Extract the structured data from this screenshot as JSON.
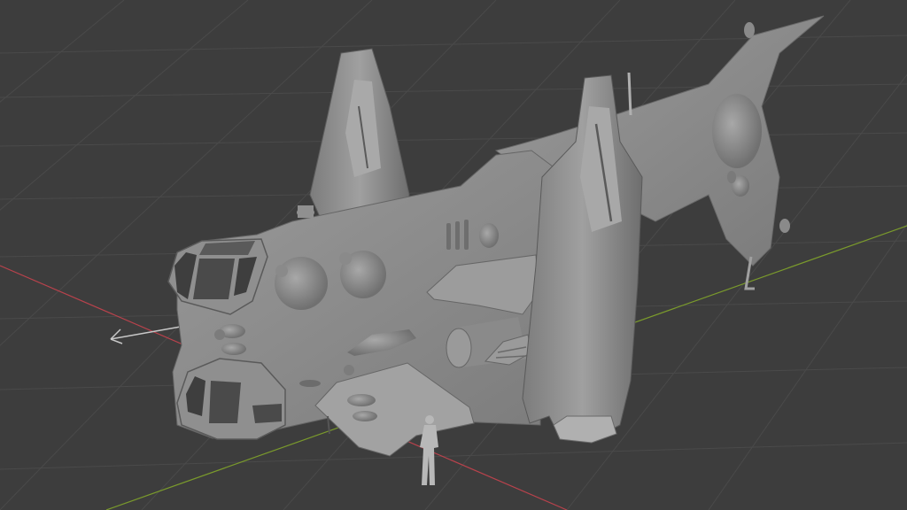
{
  "viewport": {
    "background": "#3d3d3d",
    "grid_color": "#4a4a4a",
    "x_axis_color": "#b8424c",
    "y_axis_color": "#7a9a2c",
    "grid": true
  },
  "scene": {
    "model": "tiltrotor-gunship-mesh",
    "reference_figure": "human-scale-figure",
    "empty_object": "arrow-empty",
    "mesh_color": "#8d8d8d"
  }
}
